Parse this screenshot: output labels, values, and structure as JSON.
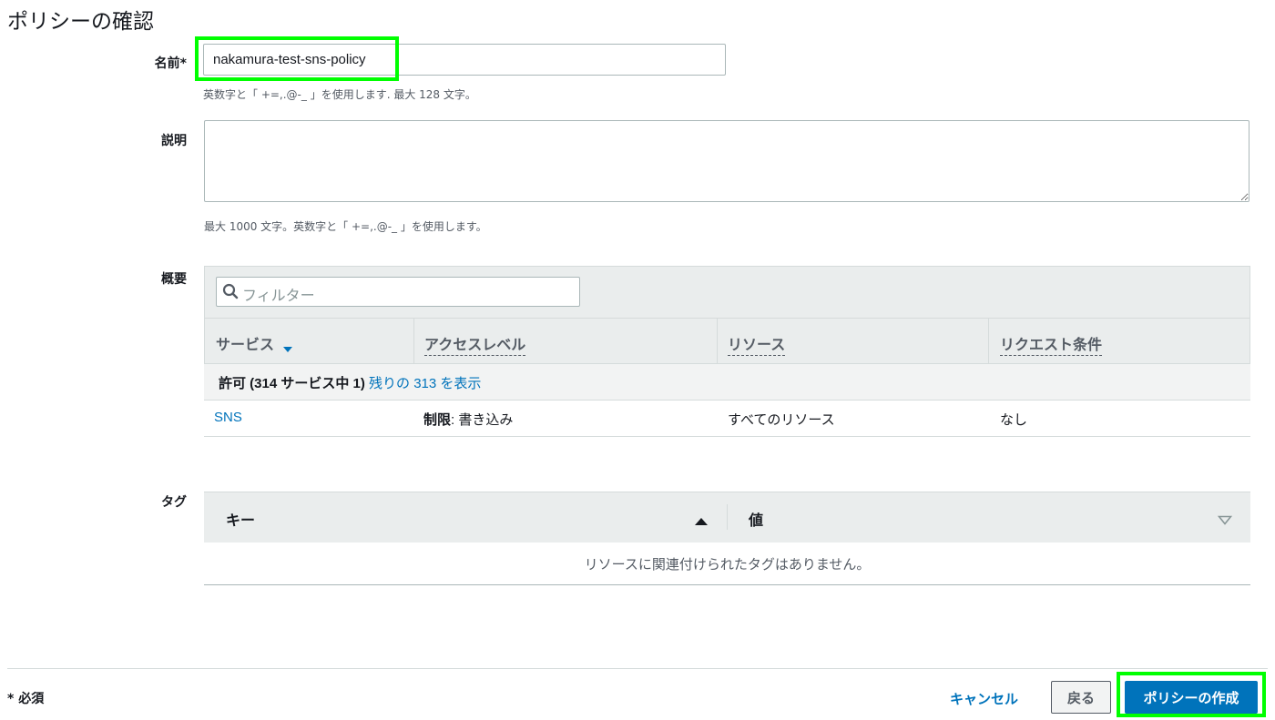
{
  "page_title": "ポリシーの確認",
  "name_field": {
    "label": "名前*",
    "value": "nakamura-test-sns-policy",
    "hint": "英数字と「 +=,.@-_ 」を使用します. 最大 128 文字。"
  },
  "description_field": {
    "label": "説明",
    "value": "",
    "hint": "最大 1000 文字。英数字と「 +=,.@-_ 」を使用します。"
  },
  "summary": {
    "label": "概要",
    "filter_placeholder": "フィルター",
    "columns": [
      "サービス",
      "アクセスレベル",
      "リソース",
      "リクエスト条件"
    ],
    "group": {
      "label": "許可 (314 サービス中 1)",
      "link": "残りの 313 を表示"
    },
    "rows": [
      {
        "service": "SNS",
        "access_level_prefix": "制限",
        "access_level": ": 書き込み",
        "resource": "すべてのリソース",
        "condition": "なし"
      }
    ]
  },
  "tags": {
    "label": "タグ",
    "columns": [
      "キー",
      "値"
    ],
    "empty_message": "リソースに関連付けられたタグはありません。"
  },
  "footer": {
    "required_note": "* 必須",
    "cancel": "キャンセル",
    "back": "戻る",
    "create": "ポリシーの作成"
  },
  "colors": {
    "accent": "#0073bb",
    "highlight": "#00ff00"
  },
  "icons": [
    "search-icon",
    "sort-down-icon",
    "sort-up-icon",
    "sort-down-outline-icon"
  ]
}
